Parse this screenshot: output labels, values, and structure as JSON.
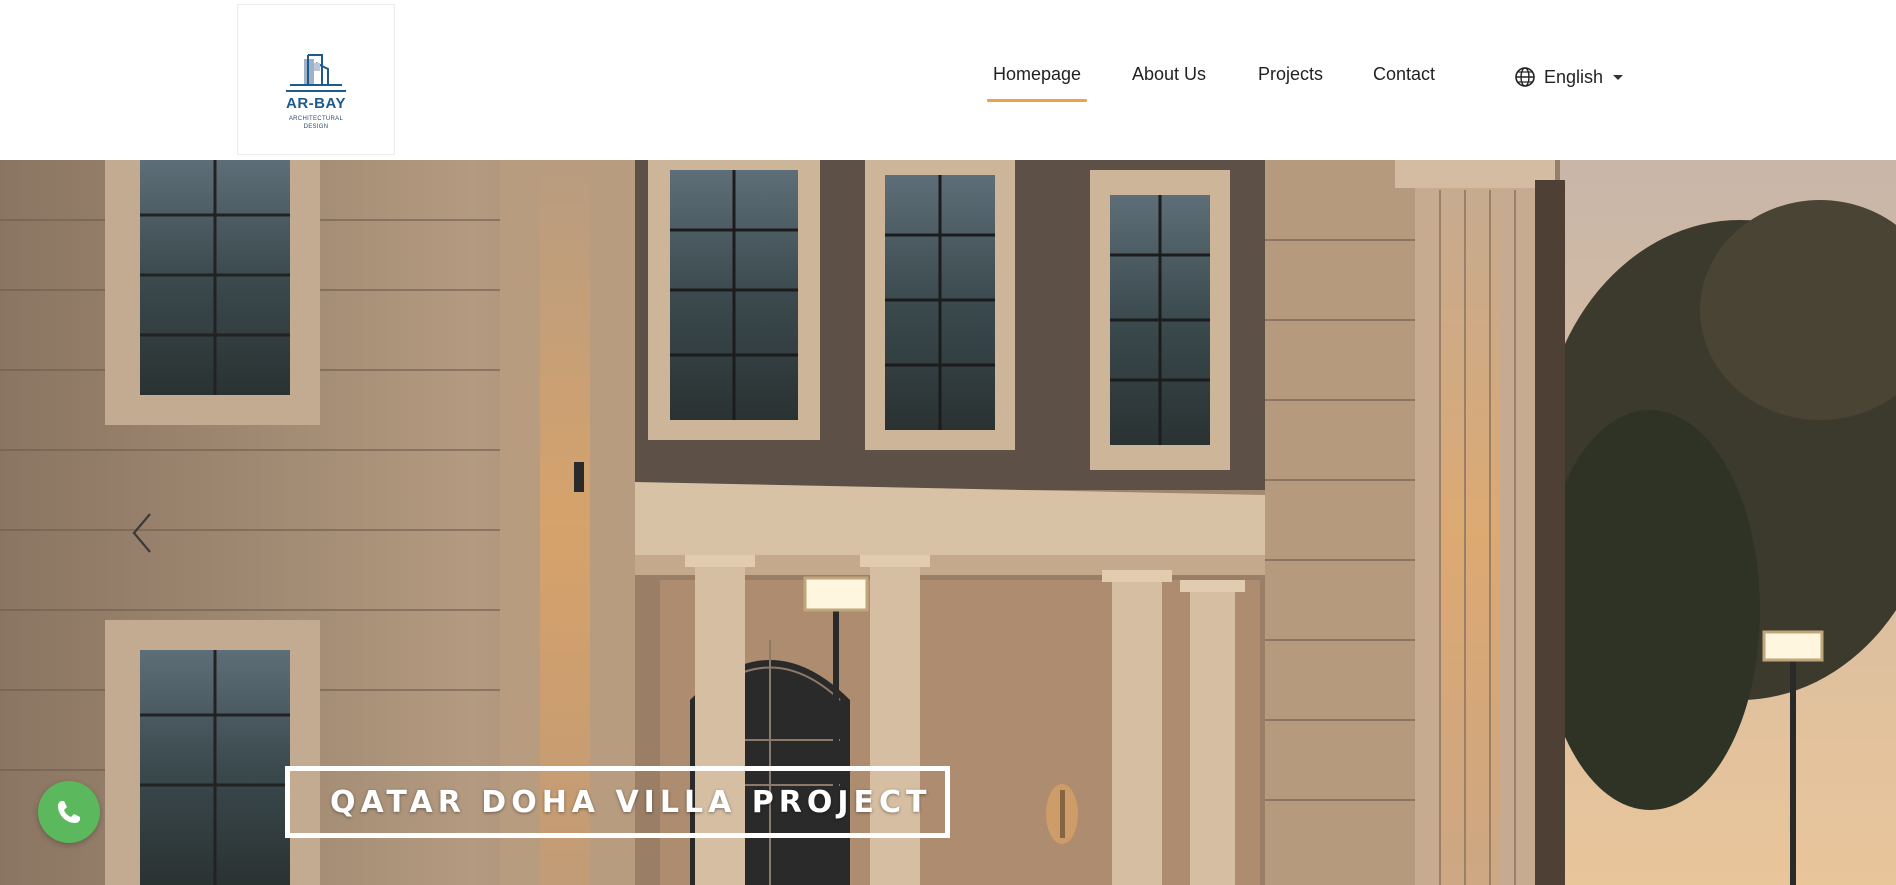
{
  "logo": {
    "name": "AR-BAY",
    "subtitle_line1": "ARCHITECTURAL",
    "subtitle_line2": "DESIGN",
    "brand_color": "#1e5a8c"
  },
  "nav": {
    "items": [
      {
        "label": "Homepage",
        "active": true
      },
      {
        "label": "About Us",
        "active": false
      },
      {
        "label": "Projects",
        "active": false
      },
      {
        "label": "Contact",
        "active": false
      }
    ],
    "active_underline_color": "#f0a04a"
  },
  "language": {
    "icon": "globe-icon",
    "selected": "English",
    "dropdown_icon": "caret-down-icon"
  },
  "hero": {
    "slide_caption": "QATAR DOHA VILLA PROJECT",
    "prev_icon": "chevron-left-icon"
  },
  "floating": {
    "whatsapp_icon": "whatsapp-phone-icon",
    "whatsapp_color": "#5cb85c"
  }
}
